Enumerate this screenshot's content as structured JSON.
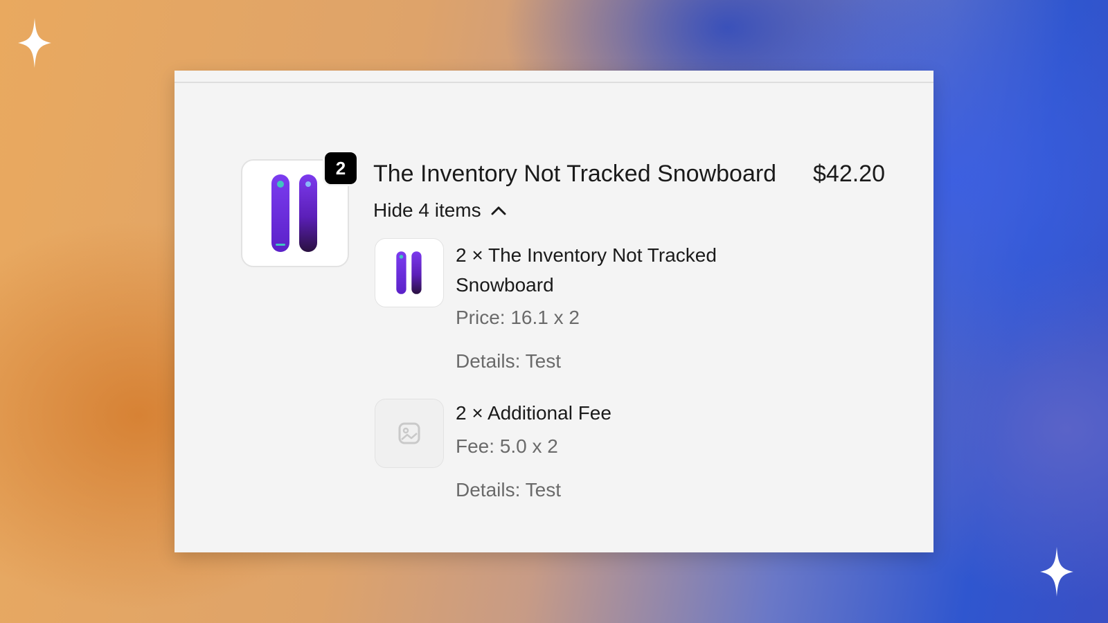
{
  "order_line": {
    "title": "The Inventory Not Tracked Snowboard",
    "price": "$42.20",
    "quantity_badge": "2",
    "thumbnail_icon": "snowboard-image",
    "toggle_label": "Hide 4 items",
    "toggle_icon": "chevron-up-icon",
    "sub_items": [
      {
        "title": "2 × The Inventory Not Tracked Snowboard",
        "icon": "snowboard-image",
        "price_line": "Price: 16.1 x 2",
        "details_line": "Details: Test"
      },
      {
        "title": "2 × Additional Fee",
        "icon": "image-placeholder-icon",
        "price_line": "Fee: 5.0 x 2",
        "details_line": "Details: Test"
      }
    ]
  },
  "colors": {
    "badge_bg": "#000000",
    "card_bg": "#f4f4f4",
    "snowboard_purple": "#6a2ee0"
  }
}
